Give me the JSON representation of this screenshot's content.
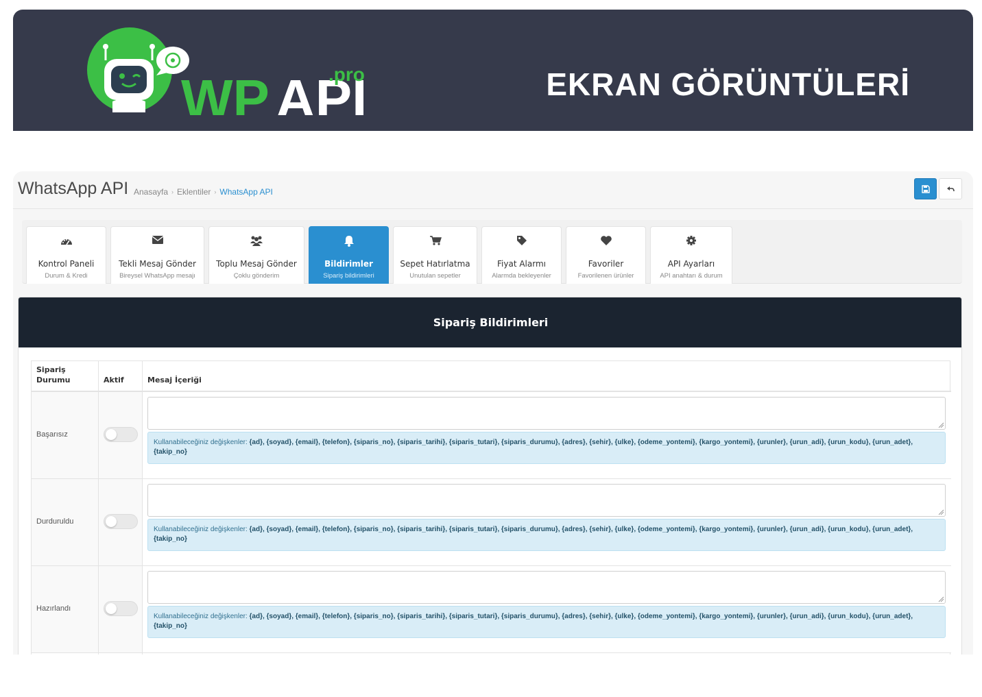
{
  "banner": {
    "logo_main": "WPAPI",
    "logo_suffix": ".pro",
    "title": "EKRAN GÖRÜNTÜLERİ"
  },
  "header": {
    "title": "WhatsApp API",
    "breadcrumb": [
      "Anasayfa",
      "Eklentiler",
      "WhatsApp API"
    ]
  },
  "toolbar": {
    "save_icon": "floppy-disk-icon",
    "back_icon": "reply-arrow-icon"
  },
  "colors": {
    "accent": "#2a8fd0",
    "banner_bg": "#363a4b",
    "panel_head_bg": "#1b2430",
    "logo_green": "#3cbf46"
  },
  "tabs": [
    {
      "label": "Kontrol Paneli",
      "sub": "Durum & Kredi",
      "icon": "dashboard-icon",
      "active": false
    },
    {
      "label": "Tekli Mesaj Gönder",
      "sub": "Bireysel WhatsApp mesajı",
      "icon": "envelope-icon",
      "active": false
    },
    {
      "label": "Toplu Mesaj Gönder",
      "sub": "Çoklu gönderim",
      "icon": "users-icon",
      "active": false
    },
    {
      "label": "Bildirimler",
      "sub": "Sipariş bildirimleri",
      "icon": "bell-icon",
      "active": true
    },
    {
      "label": "Sepet Hatırlatma",
      "sub": "Unutulan sepetler",
      "icon": "cart-icon",
      "active": false
    },
    {
      "label": "Fiyat Alarmı",
      "sub": "Alarmda bekleyenler",
      "icon": "tag-icon",
      "active": false
    },
    {
      "label": "Favoriler",
      "sub": "Favorilenen ürünler",
      "icon": "heart-icon",
      "active": false
    },
    {
      "label": "API Ayarları",
      "sub": "API anahtarı & durum",
      "icon": "gear-icon",
      "active": false
    }
  ],
  "panel": {
    "title": "Sipariş Bildirimleri",
    "columns": {
      "status": "Sipariş Durumu",
      "active": "Aktif",
      "message": "Mesaj İçeriği"
    },
    "vars_prefix": "Kullanabileceğiniz değişkenler: ",
    "vars_list": "{ad}, {soyad}, {email}, {telefon}, {siparis_no}, {siparis_tarihi}, {siparis_tutari}, {siparis_durumu}, {adres}, {sehir}, {ulke}, {odeme_yontemi}, {kargo_yontemi}, {urunler}, {urun_adi}, {urun_kodu}, {urun_adet}, {takip_no}",
    "rows": [
      {
        "status": "Başarısız",
        "active": false,
        "message": ""
      },
      {
        "status": "Durduruldu",
        "active": false,
        "message": ""
      },
      {
        "status": "Hazırlandı",
        "active": false,
        "message": ""
      }
    ]
  }
}
